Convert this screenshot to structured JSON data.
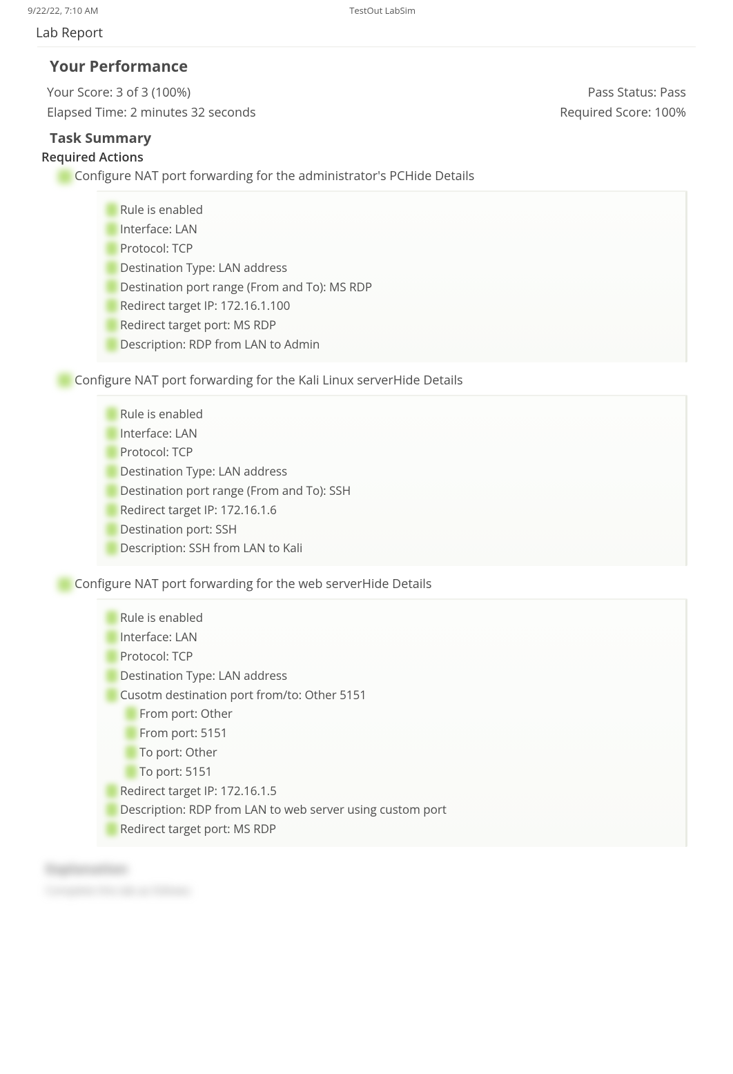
{
  "header": {
    "timestamp": "9/22/22, 7:10 AM",
    "product": "TestOut LabSim"
  },
  "lab_report_label": "Lab Report",
  "performance": {
    "title": "Your Performance",
    "score_label": "Your Score: 3 of 3 (100%)",
    "pass_status": "Pass Status: Pass",
    "elapsed": "Elapsed Time: 2 minutes 32 seconds",
    "required_score": "Required Score: 100%"
  },
  "task_summary": {
    "title": "Task Summary",
    "required_actions_label": "Required Actions",
    "hide_details_label": "Hide Details",
    "actions": [
      {
        "title": "Configure NAT port forwarding for the administrator's PC",
        "details": [
          "Rule is enabled",
          "Interface: LAN",
          "Protocol: TCP",
          "Destination Type: LAN address",
          "Destination port range (From and To): MS RDP",
          "Redirect target IP: 172.16.1.100",
          "Redirect target port: MS RDP",
          "Description: RDP from LAN to Admin"
        ]
      },
      {
        "title": "Configure NAT port forwarding for the Kali Linux server",
        "details": [
          "Rule is enabled",
          "Interface: LAN",
          "Protocol: TCP",
          "Destination Type: LAN address",
          "Destination port range (From and To): SSH",
          "Redirect target IP: 172.16.1.6",
          "Destination port: SSH",
          "Description: SSH from LAN to Kali"
        ]
      },
      {
        "title": "Configure NAT port forwarding for the web server",
        "details": [
          "Rule is enabled",
          "Interface: LAN",
          "Protocol: TCP",
          "Destination Type: LAN address",
          "Cusotm destination port from/to: Other 5151"
        ],
        "sub_details": [
          "From port: Other",
          "From port: 5151",
          "To port: Other",
          "To port: 5151"
        ],
        "details_after": [
          "Redirect target IP: 172.16.1.5",
          "Description: RDP from LAN to web server using custom port",
          "Redirect target port: MS RDP"
        ]
      }
    ]
  },
  "explanation": {
    "heading": "Explanation",
    "subtext": "Complete this lab as follows:"
  }
}
